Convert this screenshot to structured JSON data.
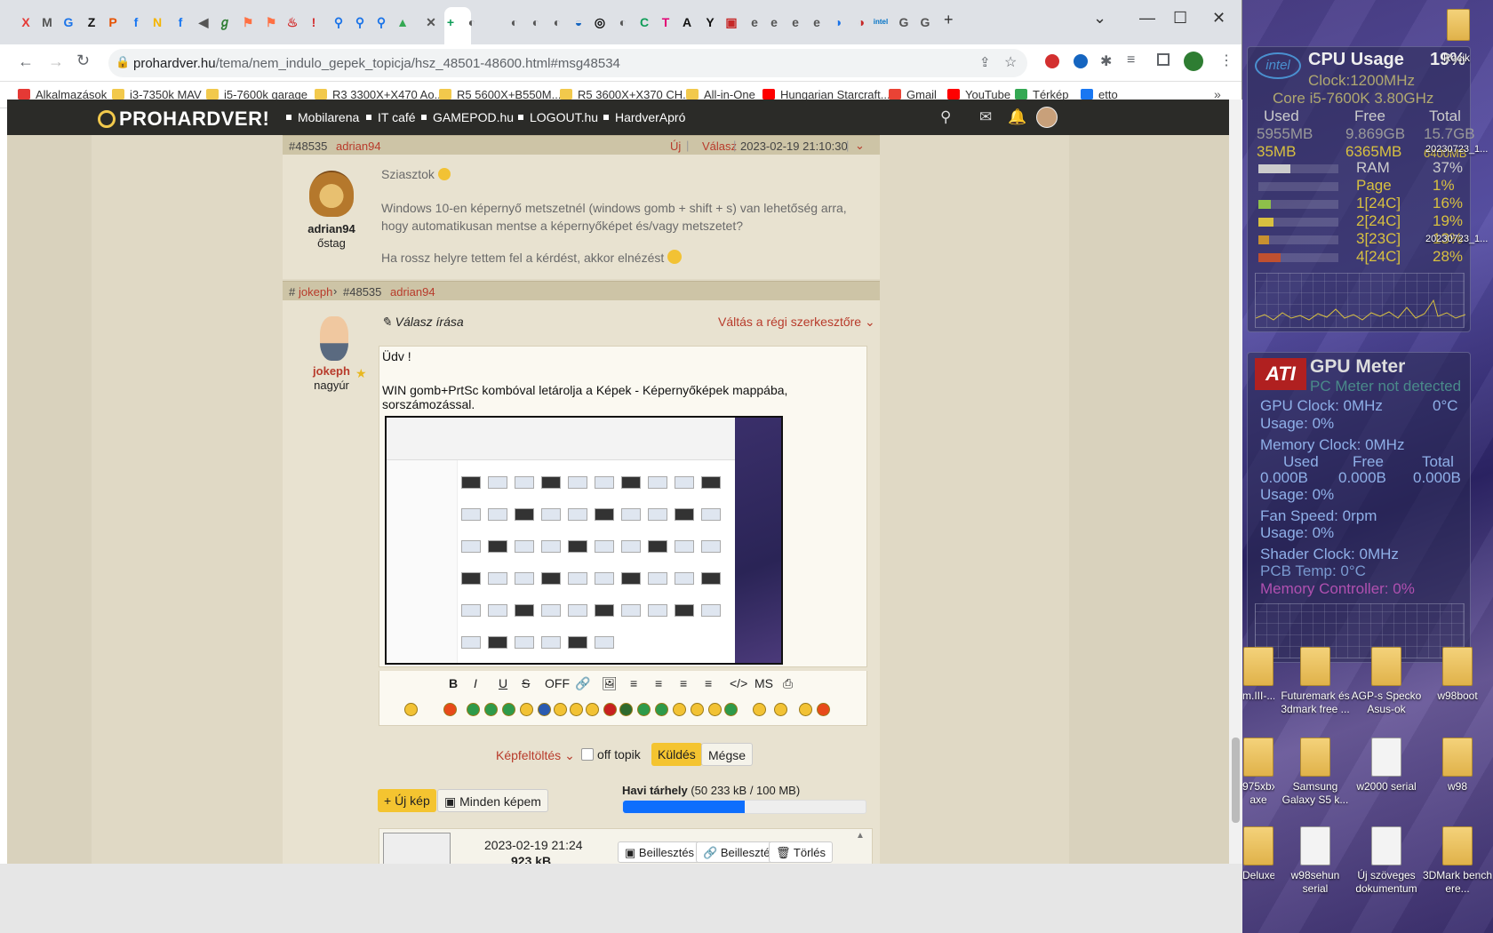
{
  "browser": {
    "url_main": "prohardver.hu",
    "url_path": "/tema/nem_indulo_gepek_topicja/hsz_48501-48600.html#msg48534",
    "tab_icons": [
      "X",
      "M",
      "G",
      "Z",
      "P",
      "f",
      "N",
      "f",
      "◀",
      "ℊ",
      "⚑",
      "⚑",
      "♨",
      "!",
      "⚲",
      "⚲",
      "⚲",
      "▲",
      "✕",
      "+",
      "◐",
      "◐",
      "◐",
      "◐",
      "◒",
      "◎",
      "◐",
      "C",
      "T",
      "A",
      "Y",
      "▣",
      "e",
      "e",
      "e",
      "e",
      "◑",
      "◑",
      "intel",
      "G",
      "G"
    ],
    "new_tab": "+",
    "window_controls": {
      "minimize": "—",
      "maximize": "☐",
      "close": "✕"
    }
  },
  "bookmarks": [
    {
      "label": "Alkalmazások",
      "icon": "apps-icon"
    },
    {
      "label": "i3-7350k MAV",
      "icon": "folder-icon"
    },
    {
      "label": "i5-7600k garage",
      "icon": "folder-icon"
    },
    {
      "label": "R3 3300X+X470 Ao...",
      "icon": "folder-icon"
    },
    {
      "label": "R5 5600X+B550M...",
      "icon": "folder-icon"
    },
    {
      "label": "R5 3600X+X370 CH...",
      "icon": "folder-icon"
    },
    {
      "label": "All-in-One",
      "icon": "folder-icon"
    },
    {
      "label": "Hungarian Starcraft...",
      "icon": "youtube-icon"
    },
    {
      "label": "Gmail",
      "icon": "gmail-icon"
    },
    {
      "label": "YouTube",
      "icon": "youtube-icon"
    },
    {
      "label": "Térkép",
      "icon": "maps-icon"
    },
    {
      "label": "etto",
      "icon": "facebook-icon"
    }
  ],
  "site": {
    "logo": "PROHARDVER!",
    "nav": [
      "Mobilarena",
      "IT café",
      "GAMEPOD.hu",
      "LOGOUT.hu",
      "HardverApró"
    ]
  },
  "post1": {
    "id": "#48535",
    "author": "adrian94",
    "new_label": "Új",
    "reply_label": "Válasz",
    "timestamp": "2023-02-19 21:10:30",
    "rank": "őstag",
    "greeting": "Sziasztok",
    "body": "Windows 10-en képernyő metszetnél (windows gomb + shift + s) van lehetőség arra, hogy automatikusan mentse a képernyőképet és/vagy metszetet?",
    "closing": "Ha rossz helyre tettem fel a kérdést, akkor elnézést"
  },
  "reply": {
    "hash": "#",
    "from": "jokeph",
    "ref_id": "#48535",
    "to": "adrian94",
    "compose_title": "Válasz írása",
    "switch_editor": "Váltás a régi szerkesztőre",
    "author": "jokeph",
    "rank": "nagyúr",
    "line1": "Üdv !",
    "line2": "WIN gomb+PrtSc kombóval letárolja a Képek - Képernyőképek mappába, sorszámozással.",
    "toolbar": [
      "B",
      "I",
      "U",
      "S",
      "OFF",
      "🔗",
      "🖼",
      "≡",
      "≡",
      "≡",
      "≡",
      "</>",
      "MS",
      "⎙"
    ],
    "upload_label": "Képfeltöltés",
    "offtopic_label": "off topik",
    "send_label": "Küldés",
    "cancel_label": "Mégse"
  },
  "gallery": {
    "new_image": "+ Új kép",
    "all_images": "Minden képem",
    "quota_label": "Havi tárhely",
    "quota_value": "(50 233 kB / 100 MB)",
    "quota_fraction": 0.5,
    "item_date": "2023-02-19 21:24",
    "item_size": "923 kB",
    "insert1": "Beillesztés",
    "insert2": "Beillesztés",
    "delete": "Törlés"
  },
  "cpu_gadget": {
    "brand": "intel",
    "title": "CPU Usage",
    "title_value": "19%",
    "clock": "Clock:1200MHz",
    "model": "Core i5-7600K 3.80GHz",
    "col_used": "Used",
    "col_free": "Free",
    "col_total": "Total",
    "row1": [
      "5955MB",
      "9.869GB",
      "15.7GB"
    ],
    "row2": [
      "35MB",
      "6365MB",
      "6400MB"
    ],
    "ram": [
      "RAM",
      "37%"
    ],
    "page": [
      "Page",
      "1%"
    ],
    "cores": [
      [
        "1[24C]",
        "16%"
      ],
      [
        "2[24C]",
        "19%"
      ],
      [
        "3[23C]",
        "13%"
      ],
      [
        "4[24C]",
        "28%"
      ]
    ]
  },
  "gpu_gadget": {
    "brand": "ATI",
    "title": "GPU Meter",
    "subtitle": "PC Meter not detected",
    "gpu_clock": "GPU Clock: 0MHz",
    "temp": "0°C",
    "usage1": "Usage: 0%",
    "mem_clock": "Memory Clock: 0MHz",
    "col_used": "Used",
    "col_free": "Free",
    "col_total": "Total",
    "mem_vals": [
      "0.000B",
      "0.000B",
      "0.000B"
    ],
    "usage2": "Usage: 0%",
    "fan": "Fan Speed: 0rpm",
    "usage3": "Usage: 0%",
    "shader": "Shader Clock: 0MHz",
    "pcb": "PCB Temp: 0°C",
    "mem_ctrl": "Memory Controller: 0%"
  },
  "desktop_icons": [
    {
      "label": "m.III-...",
      "type": "folder"
    },
    {
      "label": "Futuremark és 3dmark free ...",
      "type": "folder"
    },
    {
      "label": "AGP-s Specko Asus-ok",
      "type": "folder"
    },
    {
      "label": "w98boot",
      "type": "folder"
    },
    {
      "label": "975xbx axe",
      "type": "folder"
    },
    {
      "label": "Samsung Galaxy S5 k...",
      "type": "folder"
    },
    {
      "label": "w2000 serial",
      "type": "doc"
    },
    {
      "label": "w98",
      "type": "folder"
    },
    {
      "label": "Deluxe",
      "type": "folder"
    },
    {
      "label": "w98sehun serial",
      "type": "doc"
    },
    {
      "label": "Új szöveges dokumentum",
      "type": "doc"
    },
    {
      "label": "3DMark bench ere...",
      "type": "folder"
    }
  ],
  "desktop_misc": {
    "top_label": "Rocik",
    "file1": "20230723_1...",
    "file2": "20230723_1..."
  }
}
